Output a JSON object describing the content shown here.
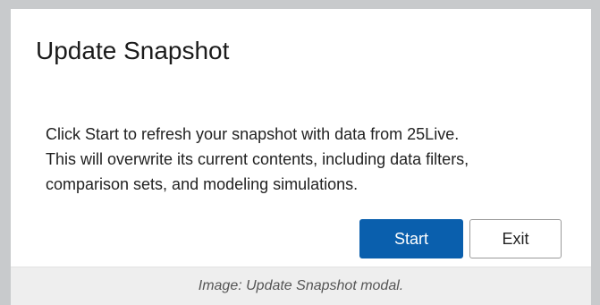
{
  "modal": {
    "title": "Update Snapshot",
    "body_lines": [
      "Click Start to refresh your snapshot with data from 25Live.",
      "This will overwrite its current contents, including data filters,",
      "comparison sets, and modeling simulations."
    ],
    "start_label": "Start",
    "exit_label": "Exit"
  },
  "caption": "Image: Update Snapshot modal.",
  "colors": {
    "primary_button": "#0a5fad",
    "frame": "#c8cacc",
    "caption_bg": "#eeeeee"
  }
}
